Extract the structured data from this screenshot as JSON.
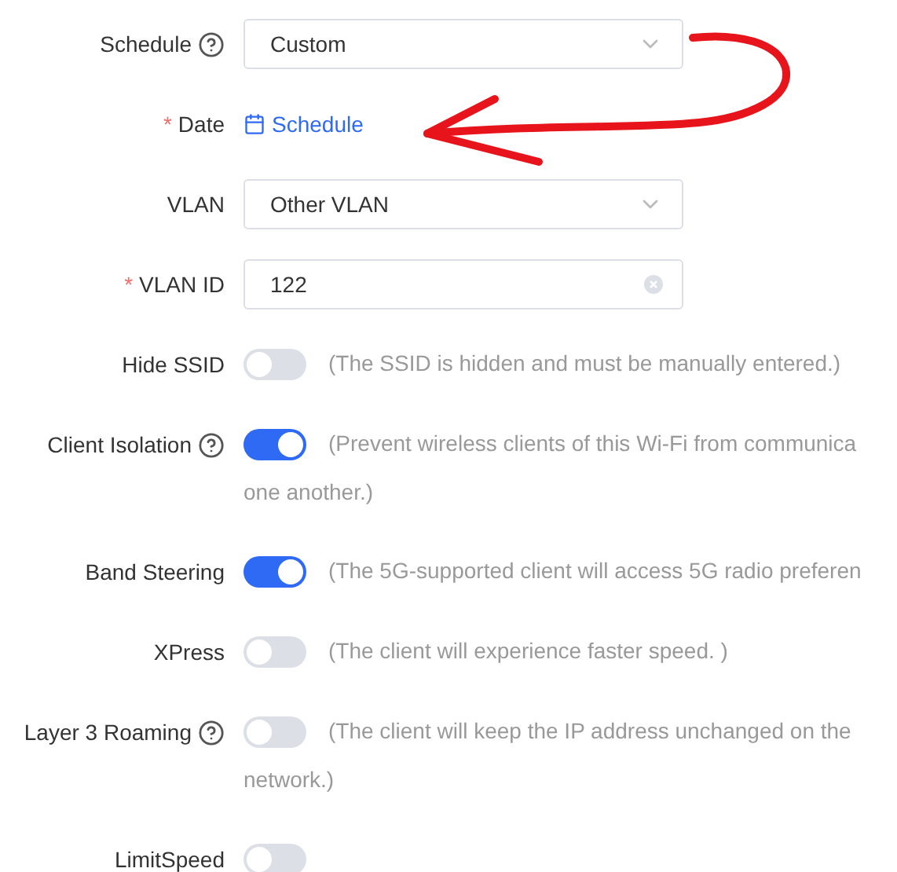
{
  "fields": [
    {
      "kind": "select",
      "label": "Schedule",
      "help": true,
      "value": "Custom"
    },
    {
      "kind": "link",
      "label": "Date",
      "help": false,
      "required_mark": "*",
      "value": "Schedule"
    },
    {
      "kind": "select",
      "label": "VLAN",
      "help": false,
      "value": "Other VLAN"
    },
    {
      "kind": "text",
      "label": "VLAN ID",
      "help": false,
      "required_mark": "*",
      "value": "122"
    },
    {
      "kind": "switch",
      "label": "Hide SSID",
      "help": false,
      "on": false,
      "lines": [
        "(The SSID is hidden and must be manually entered.)"
      ]
    },
    {
      "kind": "switch",
      "label": "Client Isolation",
      "help": true,
      "on": true,
      "lines": [
        "(Prevent wireless clients of this Wi-Fi from communica",
        "one another.)"
      ]
    },
    {
      "kind": "switch",
      "label": "Band Steering",
      "help": false,
      "on": true,
      "lines": [
        "(The 5G-supported client will access 5G radio preferen"
      ]
    },
    {
      "kind": "switch",
      "label": "XPress",
      "help": false,
      "on": false,
      "lines": [
        "(The client will experience faster speed. )"
      ]
    },
    {
      "kind": "switch",
      "label": "Layer 3 Roaming",
      "help": true,
      "on": false,
      "lines": [
        "(The client will keep the IP address unchanged on the",
        "network.)"
      ]
    },
    {
      "kind": "switch",
      "label": "LimitSpeed",
      "help": false,
      "on": false
    }
  ]
}
